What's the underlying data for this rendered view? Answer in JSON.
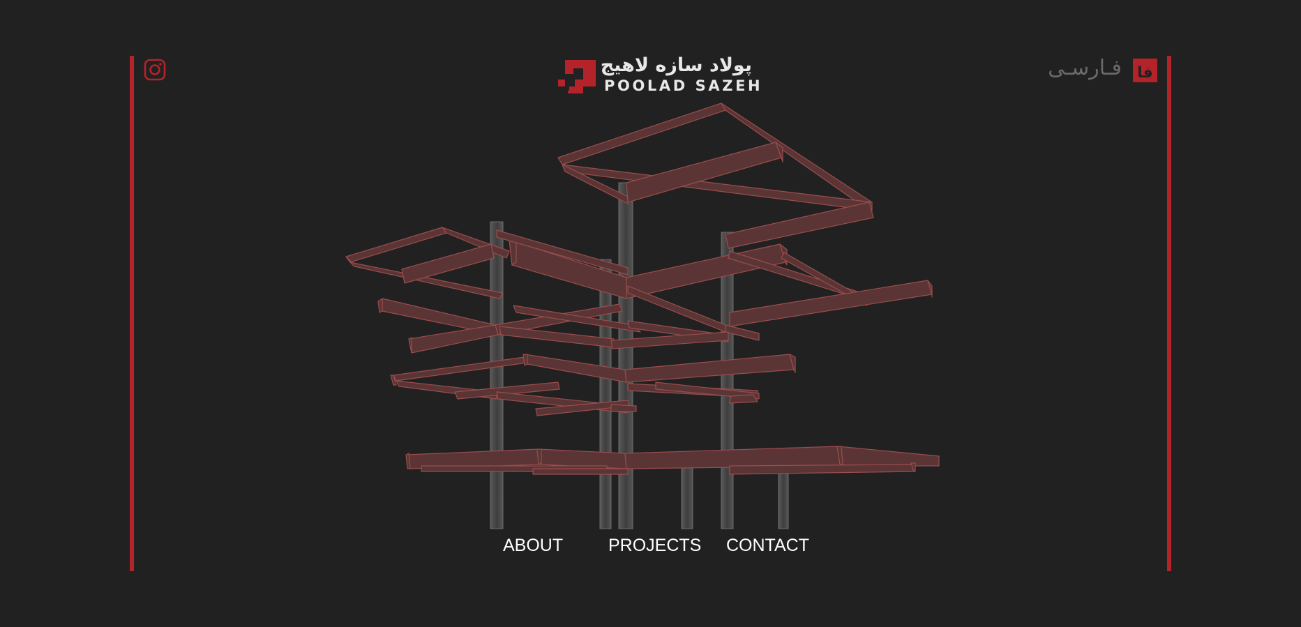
{
  "brand": {
    "name_fa": "پولاد سازه لاهیج",
    "name_en": "POOLAD SAZEH",
    "accent_color": "#b4232a",
    "background_color": "#212121"
  },
  "header": {
    "social_icon": "instagram-icon",
    "language_label": "فـارسـی",
    "language_icon": "fa-badge-icon",
    "language_icon_text": "فا"
  },
  "hero": {
    "image": "steel-structure-illustration"
  },
  "nav": {
    "items": [
      {
        "label": "ABOUT"
      },
      {
        "label": "PROJECTS"
      },
      {
        "label": "CONTACT"
      }
    ]
  }
}
